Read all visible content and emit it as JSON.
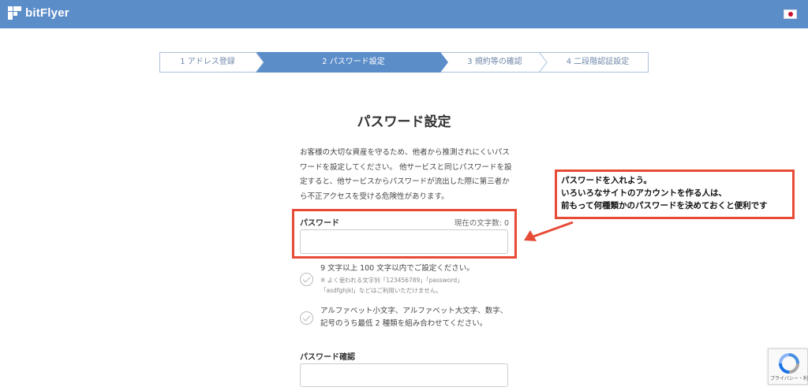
{
  "header": {
    "logo_text": "bitFlyer",
    "language_flag": "jp-flag-icon"
  },
  "stepper": {
    "steps": [
      {
        "label": "1 アドレス登録",
        "state": "done"
      },
      {
        "label": "2 パスワード設定",
        "state": "current"
      },
      {
        "label": "3 規約等の確認",
        "state": "todo"
      },
      {
        "label": "4 二段階認証設定",
        "state": "todo"
      }
    ],
    "active_color": "#5b8dc9"
  },
  "main": {
    "title": "パスワード設定",
    "intro_lines": [
      "お客様の大切な資産を守るため、他者から推測されにくいパス",
      "ワードを設定してください。 他サービスと同じパスワードを設",
      "定すると、他サービスからパスワードが流出した際に第三者か",
      "ら不正アクセスを受ける危険性があります。"
    ],
    "password": {
      "label": "パスワード",
      "counter": "現在の文字数: 0",
      "value": ""
    },
    "rules": [
      {
        "lines": [
          "9 文字以上 100 文字以内でご設定ください。"
        ],
        "notes": [
          "※ よく使われる文字列「123456789」「password」",
          "「asdfghjkl」などはご利用いただけません。"
        ],
        "icon": "check-circle-icon"
      },
      {
        "lines": [
          "アルファベット小文字、アルファベット大文字、数字、",
          "記号のうち最低 2 種類を組み合わせてください。"
        ],
        "notes": [],
        "icon": "check-circle-icon"
      }
    ],
    "password_confirm": {
      "label": "パスワード確認",
      "value": ""
    }
  },
  "annotation": {
    "lines": [
      "パスワードを入れよう。",
      "いろいろなサイトのアカウントを作る人は、",
      "前もって何種類かのパスワードを決めておくと便利です"
    ],
    "color": "#e74b36"
  },
  "recaptcha": {
    "text": "プライバシー・利用規約"
  }
}
